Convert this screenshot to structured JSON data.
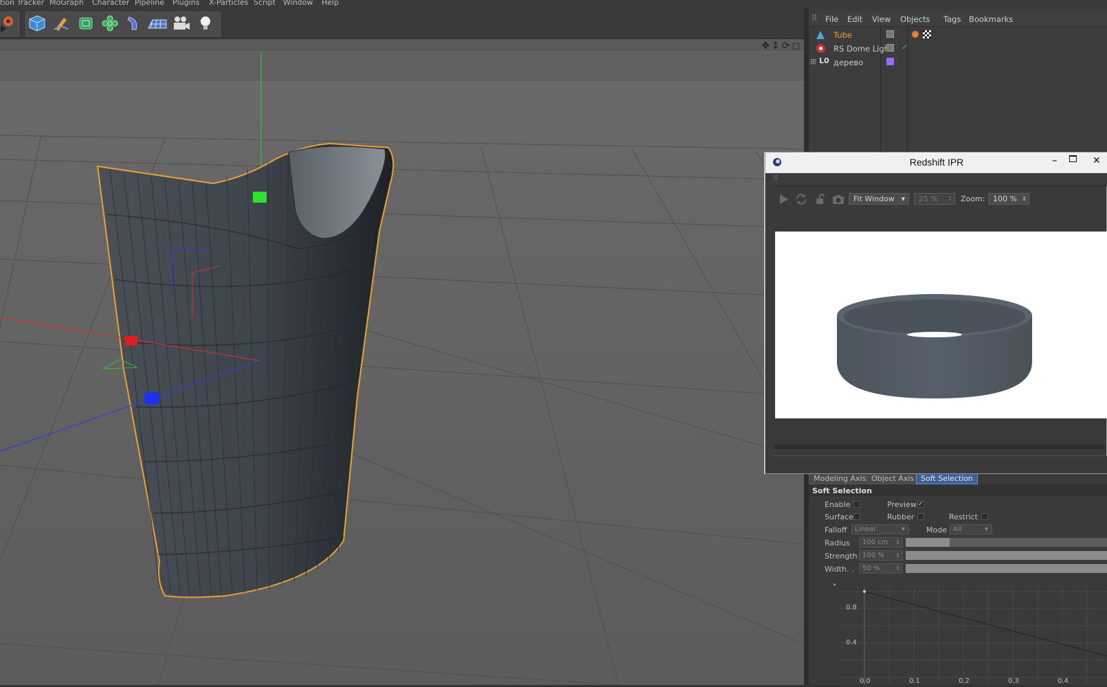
{
  "menu": {
    "items": [
      "tion Tracker",
      "MoGraph",
      "Character",
      "Pipeline",
      "Plugins",
      "X-Particles",
      "Script",
      "Window",
      "Help"
    ]
  },
  "toolbar": {
    "icons": [
      "render-settings-icon",
      "cube-icon",
      "pen-icon",
      "subdivision-icon",
      "cloner-icon",
      "deformer-icon",
      "floor-icon",
      "camera-icon",
      "light-icon"
    ]
  },
  "object_manager": {
    "menu": [
      "File",
      "Edit",
      "View",
      "Objects",
      "Tags",
      "Bookmarks"
    ],
    "objects": [
      {
        "name": "Tube",
        "color": "#f0a030",
        "icon": "tube-icon"
      },
      {
        "name": "RS Dome Light",
        "color": "#cfcfcf",
        "icon": "dome-light-icon"
      },
      {
        "name": "дерево",
        "color": "#cfcfcf",
        "icon": "null-object-icon"
      }
    ]
  },
  "ipr": {
    "title": "Redshift IPR",
    "fit_mode": "Fit Window",
    "scale": "25 %",
    "zoom_label": "Zoom:",
    "zoom": "100 %"
  },
  "attributes": {
    "tabs": [
      "Modeling Axis",
      "Object Axis",
      "Soft Selection"
    ],
    "active_tab": "Soft Selection",
    "section_title": "Soft Selection",
    "enable_label": "Enable",
    "preview_label": "Preview",
    "surface_label": "Surface",
    "rubber_label": "Rubber",
    "restrict_label": "Restrict",
    "falloff_label": "Falloff",
    "falloff_value": "Linear",
    "mode_label": "Mode",
    "mode_value": "All",
    "radius_label": "Radius",
    "radius_value": "100 cm",
    "radius_level": 0.22,
    "strength_label": "Strength",
    "strength_value": "100 %",
    "strength_level": 1.0,
    "width_label": "Width. .",
    "width_value": "50 %",
    "width_level": 1.0
  },
  "falloff_graph": {
    "y_ticks": [
      "0.8",
      "0.4"
    ],
    "x_ticks": [
      "0.0",
      "0.1",
      "0.2",
      "0.3",
      "0.4"
    ]
  }
}
